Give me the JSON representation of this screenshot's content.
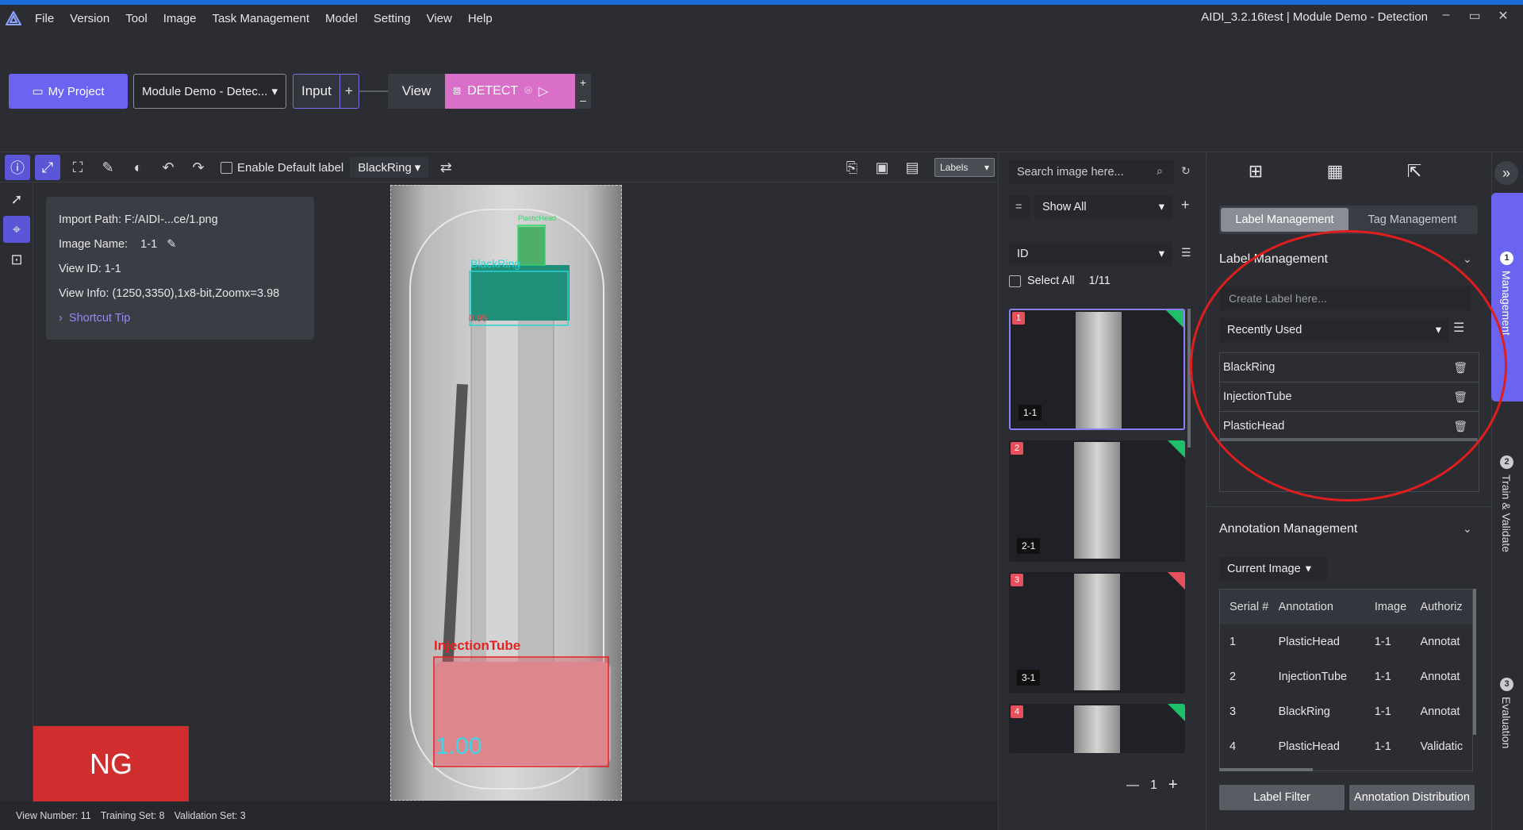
{
  "menubar": {
    "items": [
      "File",
      "Version",
      "Tool",
      "Image",
      "Task Management",
      "Model",
      "Setting",
      "View",
      "Help"
    ],
    "window_title": "AIDI_3.2.16test | Module Demo - Detection",
    "minimize": "–",
    "maximize": "▭",
    "close": "✕"
  },
  "project_bar": {
    "my_project": "My Project",
    "project_select": "Module Demo - Detec...",
    "input_label": "Input",
    "input_plus": "+",
    "view_label": "View",
    "detect_label": "DETECT",
    "add": "+",
    "remove": "–"
  },
  "image_toolbar": {
    "enable_default_label": "Enable Default label",
    "default_label_value": "BlackRing",
    "labels_select": "Labels"
  },
  "info_card": {
    "import_path": "Import Path: F:/AIDI-...ce/1.png",
    "image_name_label": "Image Name:",
    "image_name_value": "1-1",
    "view_id": "View ID: 1-1",
    "view_info": "View Info: (1250,3350),1x8-bit,Zoomx=3.98",
    "shortcut_tip": "Shortcut Tip"
  },
  "image": {
    "annotations": [
      {
        "label": "PlasticHead",
        "color": "#35d46a"
      },
      {
        "label": "BlackRing",
        "color": "#2ad4d4",
        "score": "0.99"
      },
      {
        "label": "InjectionTube",
        "color": "#e82020",
        "score": "1.00"
      }
    ]
  },
  "ng_badge": "NG",
  "status_bar": {
    "view_number": "View Number: 11",
    "training_set": "Training Set: 8",
    "validation_set": "Validation Set: 3"
  },
  "thumb_panel": {
    "search_placeholder": "Search image here...",
    "filter_eq": "=",
    "filter_value": "Show All",
    "sort_field": "ID",
    "select_all": "Select All",
    "count": "1/11",
    "page_minus": "—",
    "page_value": "1",
    "page_plus": "+",
    "thumbs": [
      {
        "index": "1",
        "view": "1-1",
        "status": "ok"
      },
      {
        "index": "2",
        "view": "2-1",
        "status": "ok"
      },
      {
        "index": "3",
        "view": "3-1",
        "status": "ng"
      },
      {
        "index": "4",
        "view": "",
        "status": "ok"
      }
    ]
  },
  "right_panel": {
    "tabs": [
      "Label Management",
      "Tag Management"
    ],
    "label_management_title": "Label Management",
    "create_label_placeholder": "Create Label here...",
    "recent_select": "Recently Used",
    "labels": [
      "BlackRing",
      "InjectionTube",
      "PlasticHead"
    ],
    "annotation_management_title": "Annotation Management",
    "current_image": "Current Image",
    "table_headers": [
      "Serial #",
      "Annotation",
      "Image",
      "Authoriz"
    ],
    "table_rows": [
      [
        "1",
        "PlasticHead",
        "1-1",
        "Annotat"
      ],
      [
        "2",
        "InjectionTube",
        "1-1",
        "Annotat"
      ],
      [
        "3",
        "BlackRing",
        "1-1",
        "Annotat"
      ],
      [
        "4",
        "PlasticHead",
        "1-1",
        "Validatic"
      ]
    ],
    "label_filter": "Label Filter",
    "annotation_distribution": "Annotation Distribution"
  },
  "step_rail": {
    "steps": [
      {
        "num": "1",
        "label": "Management"
      },
      {
        "num": "2",
        "label": "Train & Validate"
      },
      {
        "num": "3",
        "label": "Evaluation"
      }
    ]
  },
  "colors": {
    "accent": "#6b64f0",
    "detect": "#d96fc9",
    "ng": "#d02e2e",
    "ok": "#1ec06b",
    "annotation_circle": "#e01e1e"
  }
}
